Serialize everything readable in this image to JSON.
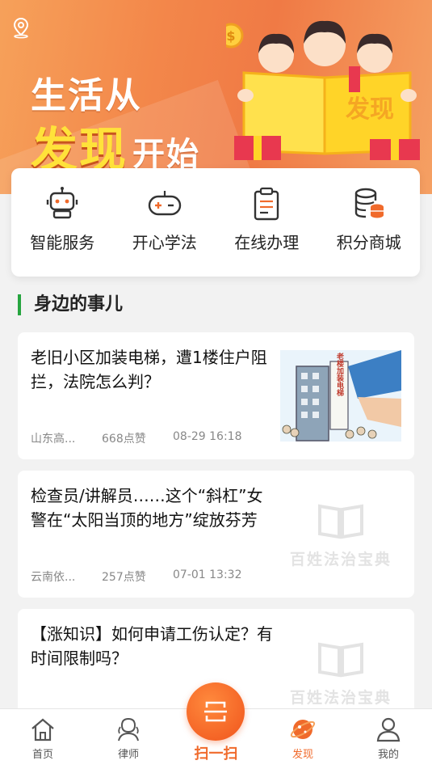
{
  "banner": {
    "slogan_line1": "生活从",
    "slogan_line2": "发现",
    "slogan_line3": "开始",
    "book_label": "发现",
    "location_icon": "location-pin-icon"
  },
  "services": [
    {
      "label": "智能服务",
      "icon": "robot-icon"
    },
    {
      "label": "开心学法",
      "icon": "gamepad-icon"
    },
    {
      "label": "在线办理",
      "icon": "clipboard-icon"
    },
    {
      "label": "积分商城",
      "icon": "coins-database-icon"
    }
  ],
  "section": {
    "title": "身边的事儿"
  },
  "articles": [
    {
      "title": "老旧小区加装电梯，遭1楼住户阻拦，法院怎么判？",
      "source": "山东高...",
      "likes": "668点赞",
      "time": "08-29 16:18",
      "thumb_label": "老楼加装电梯"
    },
    {
      "title": "检查员/讲解员……这个“斜杠”女警在“太阳当顶的地方”绽放芬芳",
      "source": "云南依...",
      "likes": "257点赞",
      "time": "07-01 13:32",
      "placeholder": "百姓法治宝典"
    },
    {
      "title": "【涨知识】如何申请工伤认定？有时间限制吗？",
      "placeholder": "百姓法治宝典"
    }
  ],
  "nav": {
    "items": [
      {
        "label": "首页",
        "icon": "home-icon"
      },
      {
        "label": "律师",
        "icon": "lawyer-icon"
      },
      {
        "label": "发现",
        "icon": "planet-icon",
        "active": true
      },
      {
        "label": "我的",
        "icon": "user-icon"
      }
    ],
    "scan_label": "扫一扫"
  },
  "colors": {
    "accent": "#f06a2b",
    "section_bar": "#27a540",
    "banner": "#f3874a"
  }
}
